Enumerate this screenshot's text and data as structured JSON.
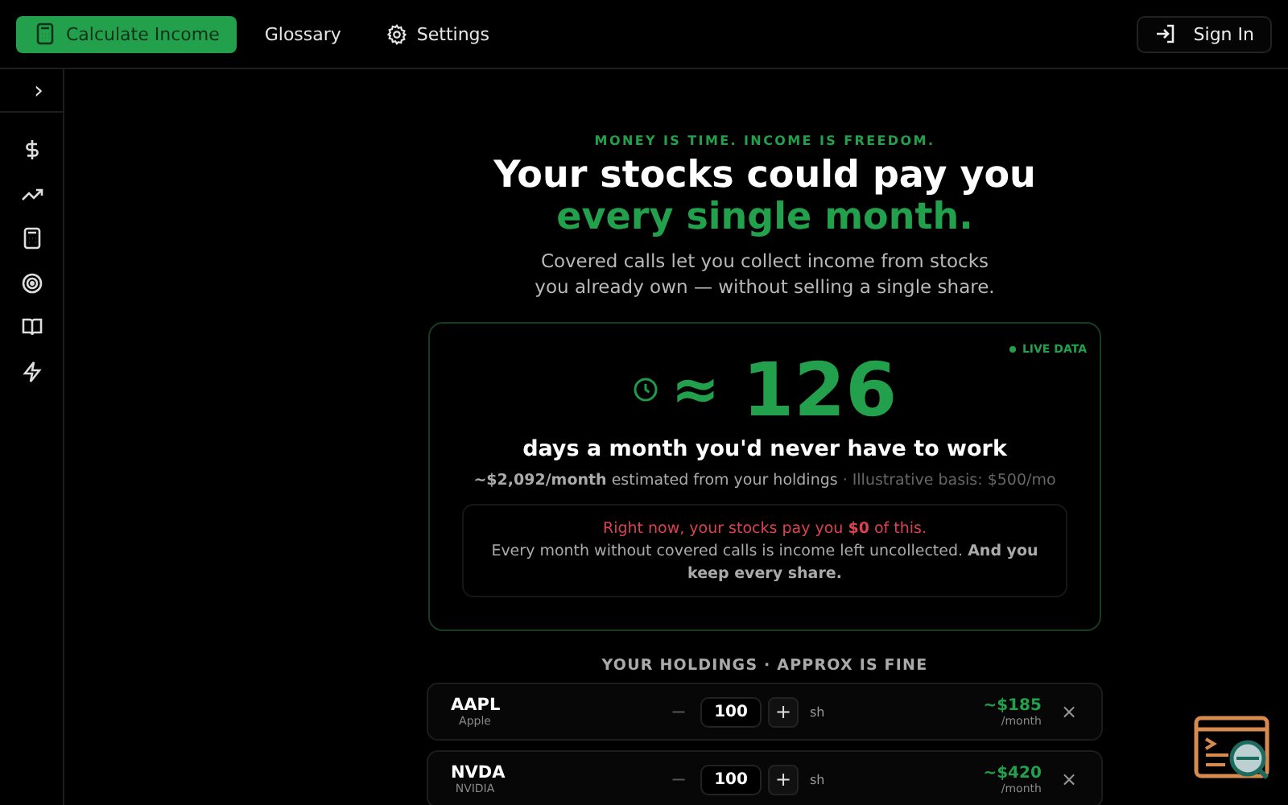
{
  "nav": {
    "items": [
      {
        "label": "Calculate Income",
        "kind": "calculator",
        "selected": true
      },
      {
        "label": "Glossary",
        "kind": "plain",
        "selected": false
      },
      {
        "label": "Settings",
        "kind": "settings",
        "selected": false
      }
    ],
    "sign_in": "Sign In"
  },
  "sidebar": {
    "toggle": "›"
  },
  "hero": {
    "eyebrow": "MONEY IS TIME. INCOME IS FREEDOM.",
    "title_line1": "Your stocks could pay you",
    "title_line2": "every single month.",
    "subtitle": "Covered calls let you collect income from stocks you already own — without selling a single share."
  },
  "card": {
    "live_badge": "LIVE DATA",
    "approx": "≈",
    "days": "126",
    "caption": "days a month you'd never have to work",
    "estimate": "**~$2,092/month** estimated from your holdings",
    "basis": "· Illustrative basis: $500/mo",
    "alert": {
      "headline": "Right now, your stocks pay you **$0** of this.",
      "body": "Every month without covered calls is income left uncollected. **And you keep every share.**"
    }
  },
  "holdings": {
    "heading": "YOUR HOLDINGS · APPROX IS FINE",
    "rows": [
      {
        "ticker": "AAPL",
        "name": "Apple",
        "minus": "−",
        "shares": "100",
        "plus": "+",
        "unit": "sh",
        "income": "~$185",
        "period": "/month",
        "remove": "×"
      },
      {
        "ticker": "NVDA",
        "name": "NVIDIA",
        "minus": "−",
        "shares": "100",
        "plus": "+",
        "unit": "sh",
        "income": "~$420",
        "period": "/month",
        "remove": "×"
      }
    ]
  }
}
